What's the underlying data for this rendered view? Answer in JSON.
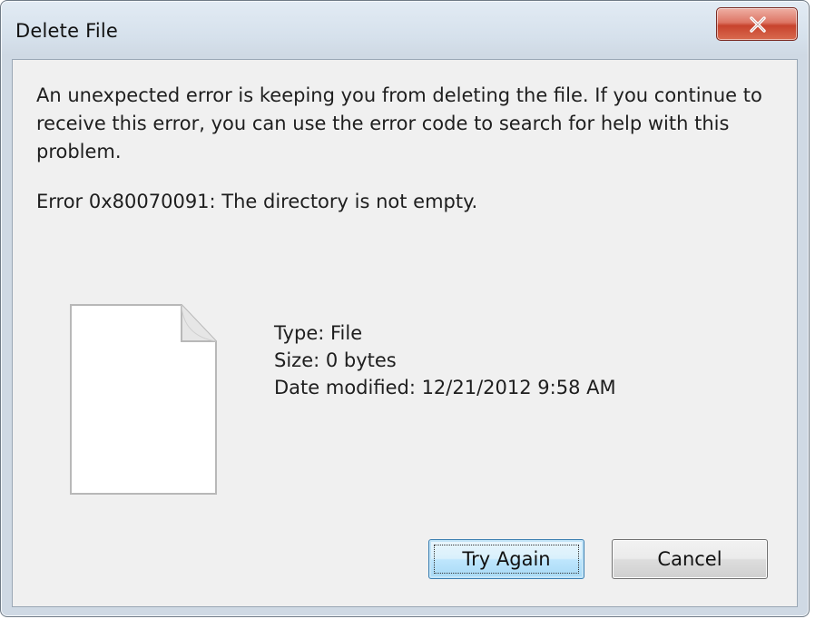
{
  "window": {
    "title": "Delete File",
    "close_icon": "close-x-icon"
  },
  "dialog": {
    "message": "An unexpected error is keeping you from deleting the file. If you continue to receive this error, you can use the error code to search for help with this problem.",
    "error": "Error 0x80070091: The directory is not empty.",
    "file_icon": "blank-document-icon",
    "details": {
      "type": "Type: File",
      "size": "Size: 0 bytes",
      "date_modified": "Date modified: 12/21/2012 9:58 AM"
    }
  },
  "buttons": {
    "try_again": "Try Again",
    "cancel": "Cancel"
  },
  "colors": {
    "close_button": "#c8432d",
    "default_button_border": "#3c7fb1",
    "client_background": "#f0f0f0"
  }
}
